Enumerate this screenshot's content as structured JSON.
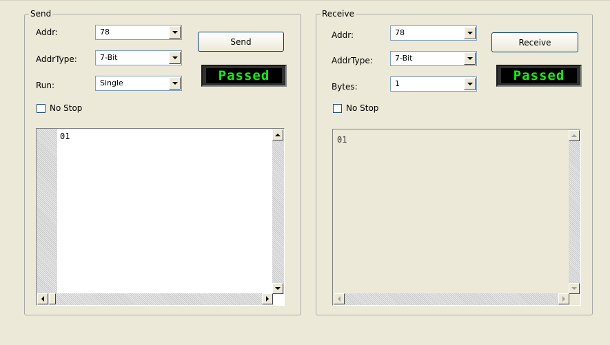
{
  "send": {
    "group_title": "Send",
    "addr_label": "Addr:",
    "addr_value": "78",
    "addrtype_label": "AddrType:",
    "addrtype_value": "7-Bit",
    "run_label": "Run:",
    "run_value": "Single",
    "button_label": "Send",
    "status": "Passed",
    "nostop_label": "No Stop",
    "nostop_checked": false,
    "data_text": "01"
  },
  "receive": {
    "group_title": "Receive",
    "addr_label": "Addr:",
    "addr_value": "78",
    "addrtype_label": "AddrType:",
    "addrtype_value": "7-Bit",
    "bytes_label": "Bytes:",
    "bytes_value": "1",
    "button_label": "Receive",
    "status": "Passed",
    "nostop_label": "No Stop",
    "nostop_checked": false,
    "data_text": "01"
  },
  "colors": {
    "window_bg": "#ece9d8",
    "led_text": "#12f012",
    "led_bg": "#000000"
  }
}
